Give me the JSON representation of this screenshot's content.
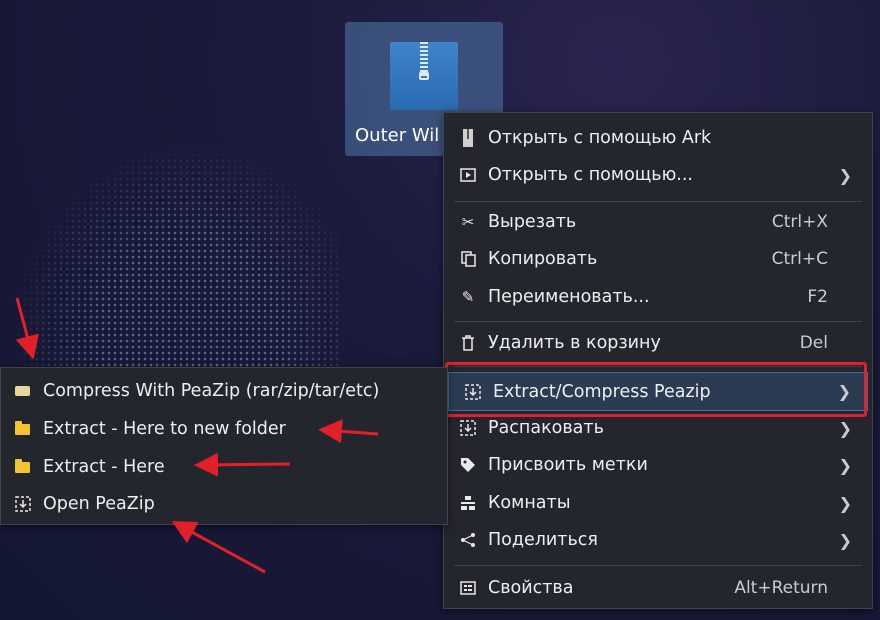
{
  "desktop": {
    "file_label": "Outer Wil"
  },
  "main_menu": {
    "items": [
      {
        "label": "Открыть с помощью Ark",
        "shortcut": "",
        "icon": "ark-icon"
      },
      {
        "label": "Открыть с помощью...",
        "shortcut": "",
        "icon": "open-with-icon"
      },
      {
        "label": "Вырезать",
        "shortcut": "Ctrl+X",
        "icon": "scissors-icon"
      },
      {
        "label": "Копировать",
        "shortcut": "Ctrl+C",
        "icon": "copy-icon"
      },
      {
        "label": "Переименовать...",
        "shortcut": "F2",
        "icon": "pencil-icon"
      },
      {
        "label": "Удалить в корзину",
        "shortcut": "Del",
        "icon": "trash-icon"
      },
      {
        "label": "Extract/Compress Peazip",
        "shortcut": "",
        "icon": "peazip-icon"
      },
      {
        "label": "Распаковать",
        "shortcut": "",
        "icon": "extract-icon"
      },
      {
        "label": "Присвоить метки",
        "shortcut": "",
        "icon": "tag-icon"
      },
      {
        "label": "Комнаты",
        "shortcut": "",
        "icon": "rooms-icon"
      },
      {
        "label": "Поделиться",
        "shortcut": "",
        "icon": "share-icon"
      },
      {
        "label": "Свойства",
        "shortcut": "Alt+Return",
        "icon": "properties-icon"
      }
    ]
  },
  "sub_menu": {
    "items": [
      {
        "label": "Compress With PeaZip (rar/zip/tar/etc)",
        "icon": "archive-icon"
      },
      {
        "label": "Extract - Here to new folder",
        "icon": "folder-icon"
      },
      {
        "label": "Extract - Here",
        "icon": "folder-icon"
      },
      {
        "label": "Open PeaZip",
        "icon": "peazip-icon"
      }
    ]
  },
  "colors": {
    "annotation": "#e2202a",
    "menu_bg": "#23262c",
    "highlight": "#2b3c52",
    "folder": "#f4c430"
  }
}
